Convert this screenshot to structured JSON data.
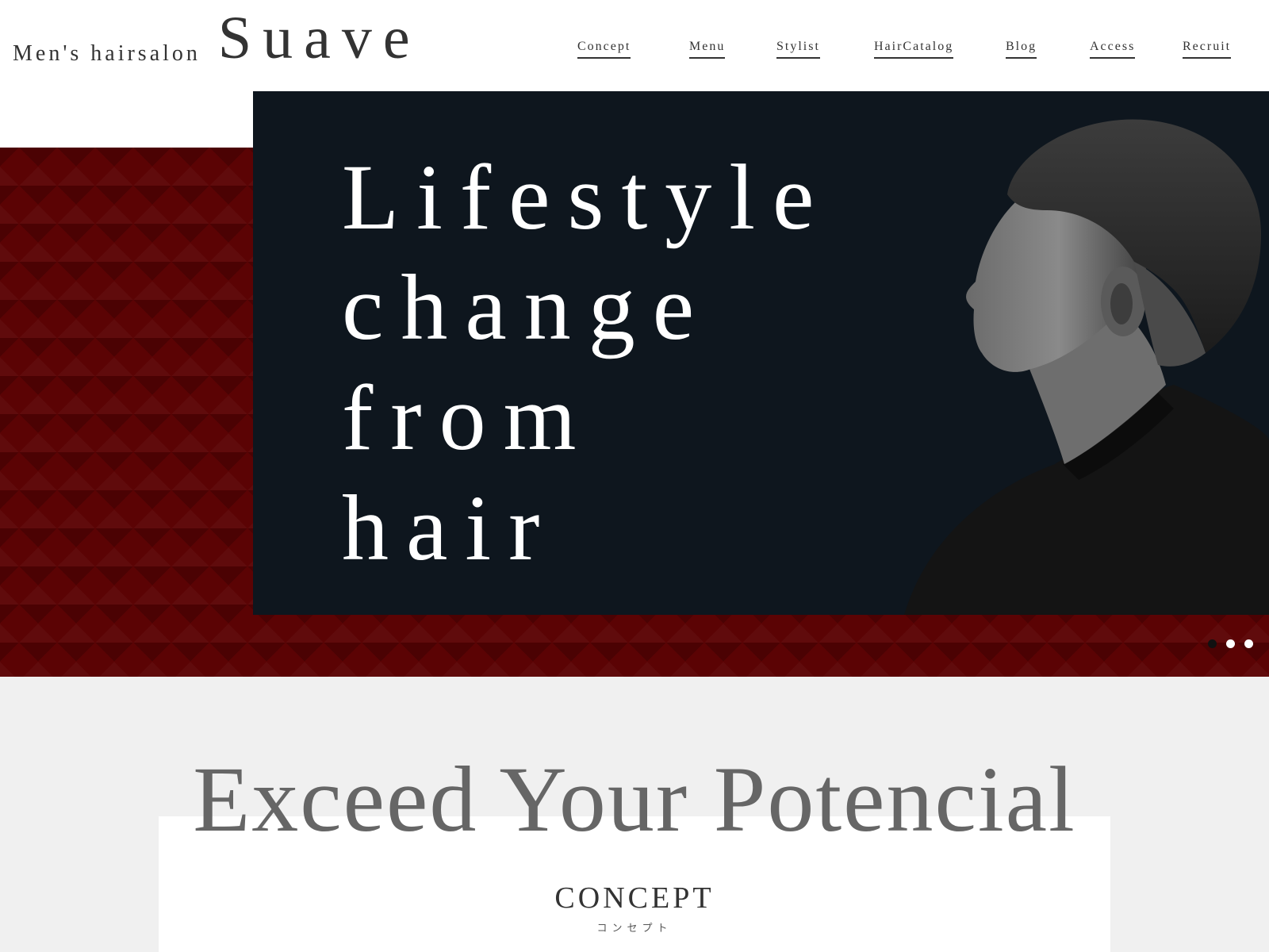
{
  "header": {
    "brand_sub": "Men's hairsalon",
    "brand_name": "Suave",
    "nav": [
      "Concept",
      "Menu",
      "Stylist",
      "HairCatalog",
      "Blog",
      "Access",
      "Recruit"
    ]
  },
  "hero": {
    "lines": [
      "Lifestyle",
      "change",
      "from",
      "hair"
    ],
    "colors": {
      "panel": "#0e161e",
      "pattern": "#5b0304",
      "text": "#ffffff"
    },
    "slider": {
      "count": 3,
      "active_index": 0
    }
  },
  "concept": {
    "heading": "Exceed Your Potencial",
    "label": "CONCEPT",
    "sub_label": "コンセプト"
  }
}
